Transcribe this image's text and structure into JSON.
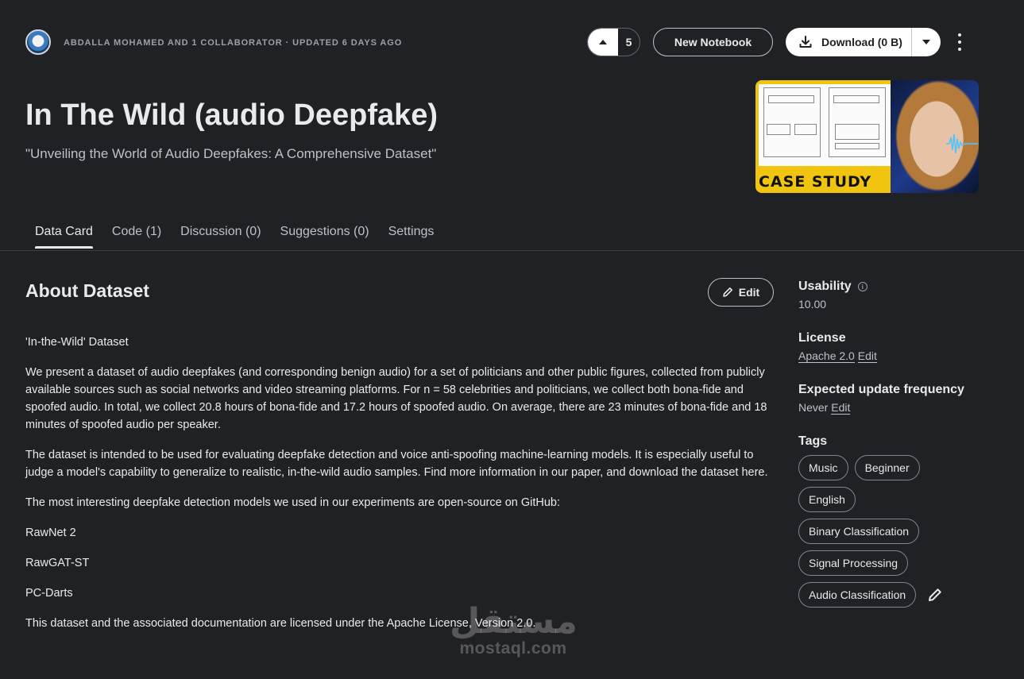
{
  "header": {
    "byline": "ABDALLA MOHAMED AND 1 COLLABORATOR · UPDATED 6 DAYS AGO",
    "vote_count": "5",
    "new_notebook_label": "New Notebook",
    "download_label": "Download (0 B)",
    "title": "In The Wild (audio Deepfake)",
    "subtitle": "\"Unveiling the World of Audio Deepfakes: A Comprehensive Dataset\""
  },
  "cover": {
    "caption": "CASE STUDY"
  },
  "tabs": [
    {
      "label": "Data Card",
      "active": true
    },
    {
      "label": "Code (1)"
    },
    {
      "label": "Discussion (0)"
    },
    {
      "label": "Suggestions (0)"
    },
    {
      "label": "Settings"
    }
  ],
  "about": {
    "heading": "About Dataset",
    "edit_label": "Edit",
    "paragraphs": [
      "'In-the-Wild' Dataset",
      "We present a dataset of audio deepfakes (and corresponding benign audio) for a set of politicians and other public figures, collected from publicly available sources such as social networks and video streaming platforms. For n = 58 celebrities and politicians, we collect both bona-fide and spoofed audio. In total, we collect 20.8 hours of bona-fide and 17.2 hours of spoofed audio. On average, there are 23 minutes of bona-fide and 18 minutes of spoofed audio per speaker.",
      "The dataset is intended to be used for evaluating deepfake detection and voice anti-spoofing machine-learning models. It is especially useful to judge a model's capability to generalize to realistic, in-the-wild audio samples. Find more information in our paper, and download the dataset here.",
      "The most interesting deepfake detection models we used in our experiments are open-source on GitHub:",
      "RawNet 2",
      "RawGAT-ST",
      "PC-Darts",
      "This dataset and the associated documentation are licensed under the Apache License, Version 2.0."
    ]
  },
  "sidebar": {
    "usability_label": "Usability",
    "usability_value": "10.00",
    "license_label": "License",
    "license_value": "Apache 2.0",
    "license_edit": "Edit",
    "frequency_label": "Expected update frequency",
    "frequency_value": "Never",
    "frequency_edit": "Edit",
    "tags_label": "Tags",
    "tags": [
      "Music",
      "Beginner",
      "English",
      "Binary Classification",
      "Signal Processing",
      "Audio Classification"
    ]
  },
  "watermark": {
    "arabic": "مستقل",
    "latin": "mostaql.com"
  },
  "colors": {
    "background": "#202124",
    "text": "#e8eaed",
    "muted": "#bdc1c6",
    "cover_accent": "#f1c40f"
  }
}
